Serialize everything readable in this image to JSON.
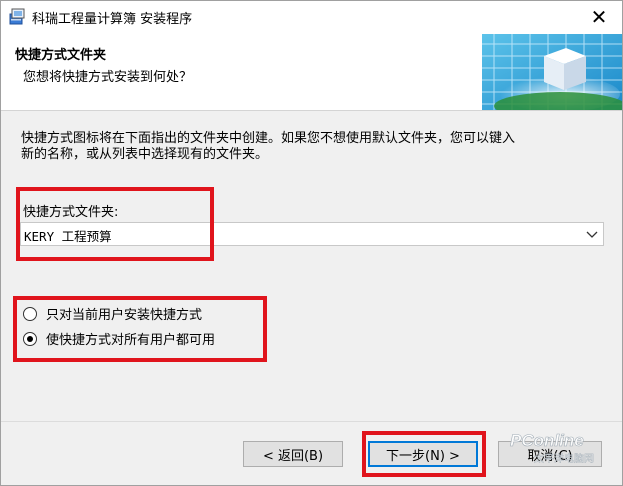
{
  "window": {
    "title": "科瑞工程量计算簿 安装程序",
    "close_glyph": "✕"
  },
  "header": {
    "title": "快捷方式文件夹",
    "subtitle": "您想将快捷方式安装到何处？"
  },
  "body": {
    "description_line1": "快捷方式图标将在下面指出的文件夹中创建。如果您不想使用默认文件夹，您可以键入",
    "description_line2": "新的名称，或从列表中选择现有的文件夹。",
    "folder_label": "快捷方式文件夹:",
    "folder_value": "KERY 工程预算"
  },
  "options": [
    {
      "label": "只对当前用户安装快捷方式",
      "checked": false
    },
    {
      "label": "使快捷方式对所有用户都可用",
      "checked": true
    }
  ],
  "buttons": {
    "back": "< 返回(B)",
    "next": "下一步(N) >",
    "cancel": "取消(C)"
  },
  "watermark": {
    "brand": "PConline",
    "sub": "太平洋电脑网"
  },
  "colors": {
    "annotation_red": "#e0141c",
    "default_button_border": "#0078d7",
    "dialog_bg": "#f0f0f0"
  }
}
